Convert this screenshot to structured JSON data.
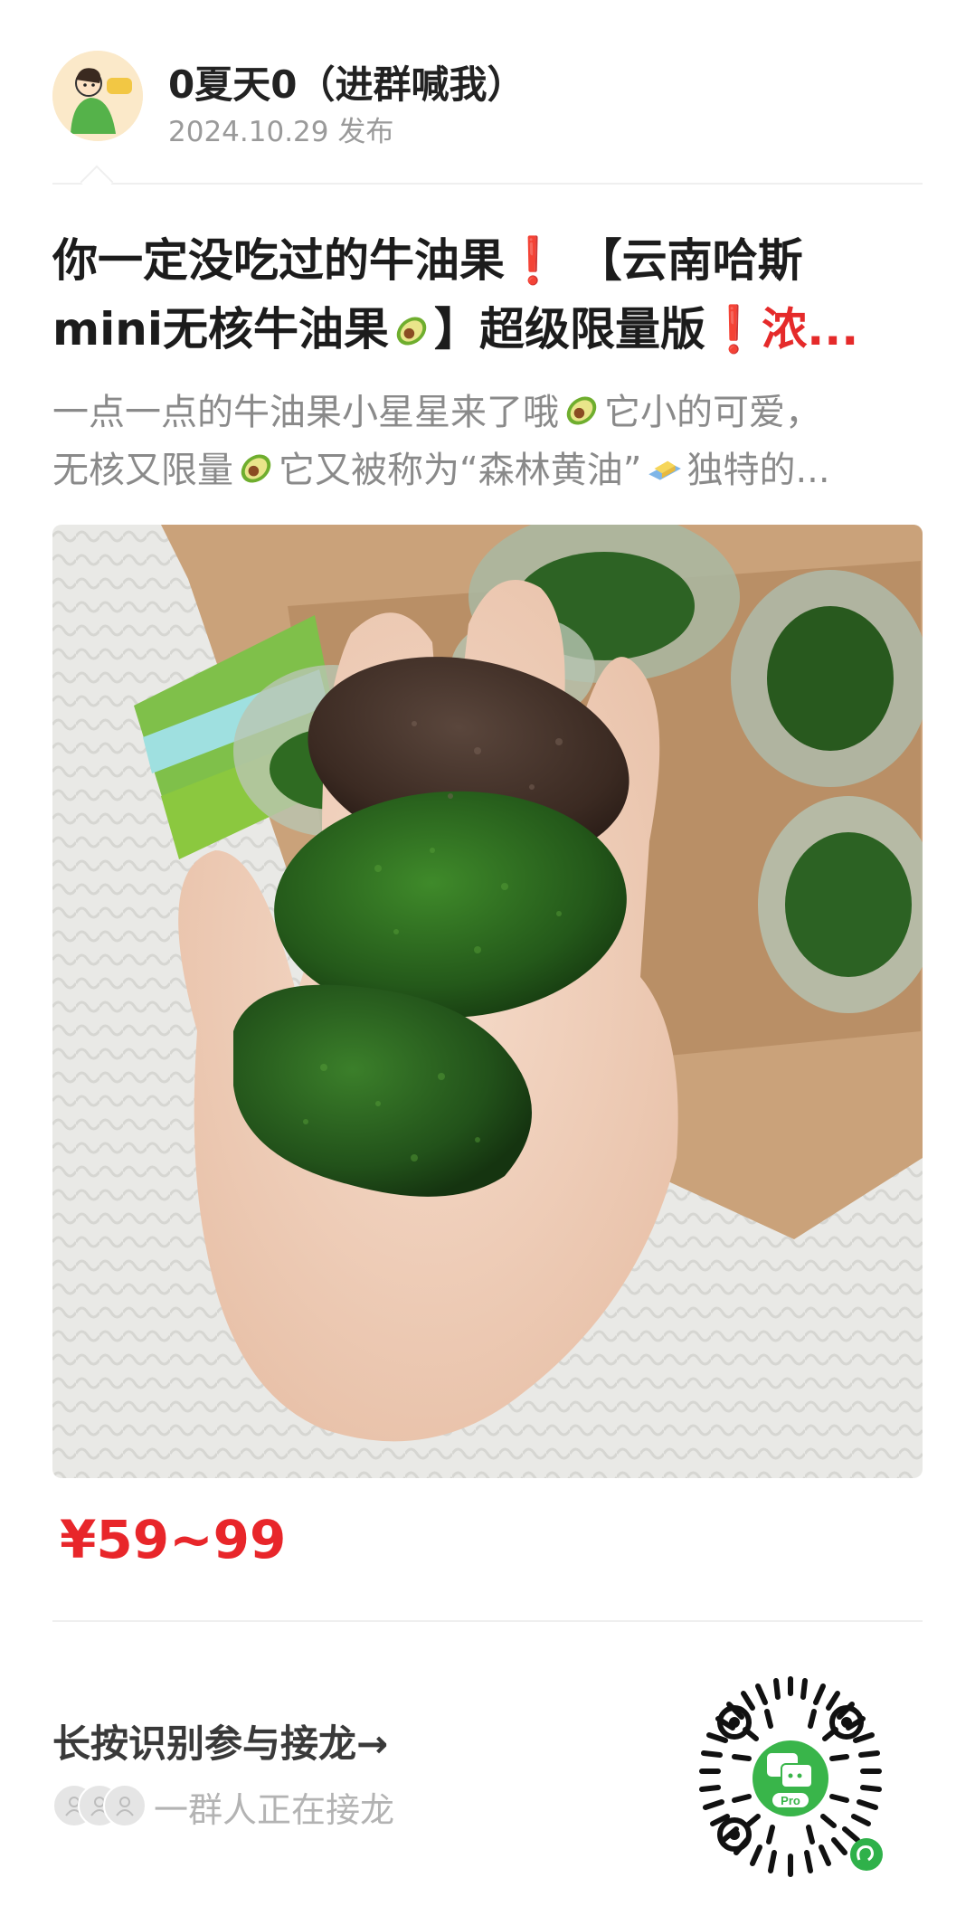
{
  "header": {
    "author": "0夏天0（进群喊我）",
    "date": "2024.10.29 发布"
  },
  "post": {
    "title_line1": "你一定没吃过的牛油果❗️ 【云南哈斯",
    "title_line2_a": "mini无核牛油果",
    "title_line2_b": "】超级限量版",
    "title_line2_c": "❗️浓...",
    "desc_line1_a": "一点一点的牛油果小星星来了哦",
    "desc_line1_b": "它小的可爱，",
    "desc_line2_a": "无核又限量",
    "desc_line2_b": "它又被称为“森林黄油”",
    "desc_line2_c": "独特的..."
  },
  "price": "¥59~99",
  "solitaire": {
    "cta": "长按识别参与接龙→",
    "participants": "一群人正在接龙",
    "qr_badge": "Pro"
  },
  "colors": {
    "price": "#e8262a",
    "accent_green": "#39b54a",
    "avocado_dark": "#3f2b22",
    "avocado_green": "#2f6b22"
  },
  "icons": [
    "avocado-emoji-icon",
    "butter-emoji-icon",
    "red-exclamation-icon",
    "miniprogram-logo-icon"
  ]
}
